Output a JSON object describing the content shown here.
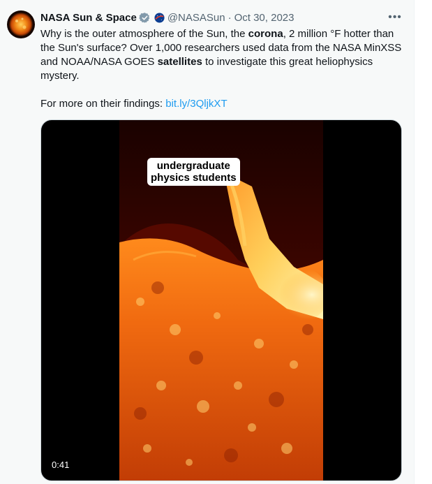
{
  "tweet": {
    "author_name": "NASA Sun & Space",
    "author_handle": "@NASASun",
    "separator": "·",
    "date": "Oct 30, 2023",
    "more_label": "•••",
    "text": {
      "p1_a": "Why is the outer atmosphere of the Sun, the ",
      "p1_b": "corona",
      "p1_c": ", 2 million °F hotter than the Sun's surface? Over 1,000 researchers used data from the NASA MinXSS and NOAA/NASA GOES ",
      "p1_d": "satellites",
      "p1_e": " to investigate this great heliophysics mystery.",
      "p2_a": "For more on their findings: ",
      "p2_link": "bit.ly/3QljkXT"
    },
    "media": {
      "caption_line1": "undergraduate",
      "caption_line2": "physics students",
      "duration": "0:41"
    },
    "icons": {
      "avatar": "sun-avatar-icon",
      "verified": "verified-badge-icon",
      "affiliate": "nasa-meatball-icon",
      "more": "more-options-icon"
    },
    "colors": {
      "link": "#1d9bf0",
      "secondary_text": "#536471",
      "background": "#f7f9f9"
    }
  }
}
